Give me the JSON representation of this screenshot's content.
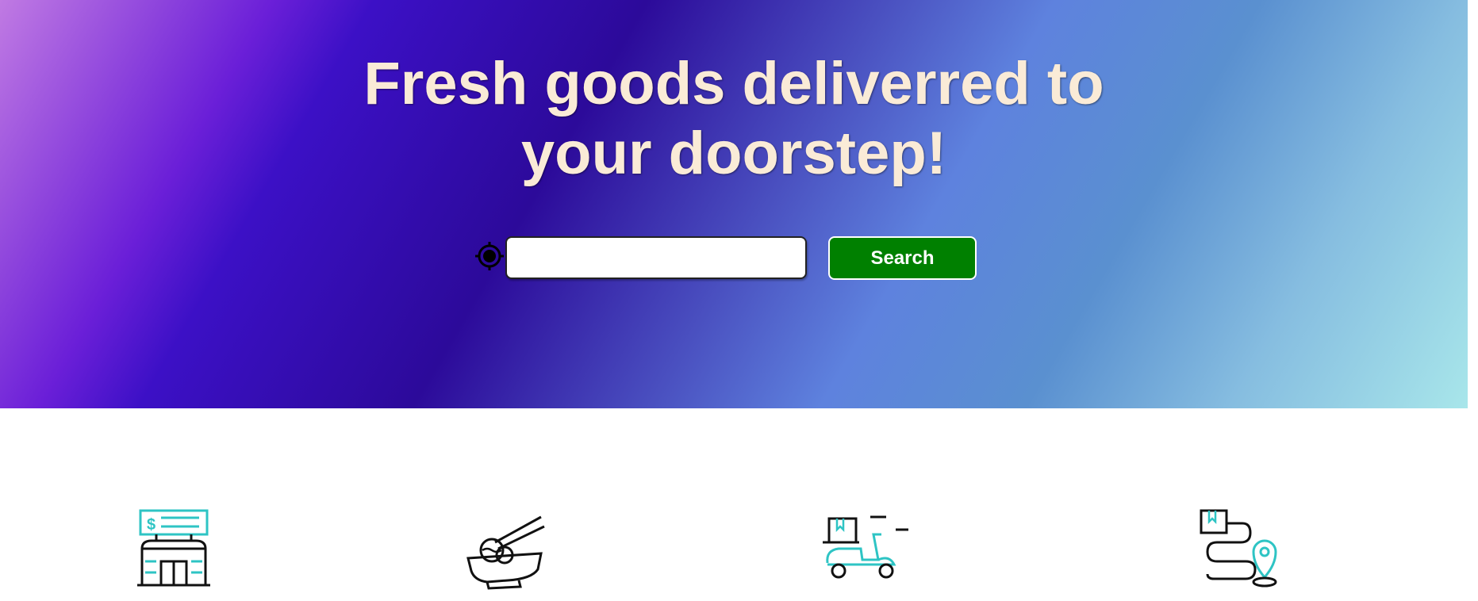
{
  "hero": {
    "title_line1": "Fresh goods deliverred to",
    "title_line2": "your doorstep!",
    "gradient_colors": [
      "#c07ae3",
      "#3c10c6",
      "#2c0a9a",
      "#5e82de",
      "#a8e6ea"
    ],
    "title_color": "#faebd7"
  },
  "search": {
    "location_icon": "crosshair-locate-icon",
    "input_value": "",
    "button_label": "Search",
    "button_color": "#008000"
  },
  "features": {
    "icons": [
      "store-icon",
      "noodle-bowl-icon",
      "delivery-scooter-icon",
      "package-route-icon"
    ],
    "accent_color": "#2ec4c4"
  }
}
